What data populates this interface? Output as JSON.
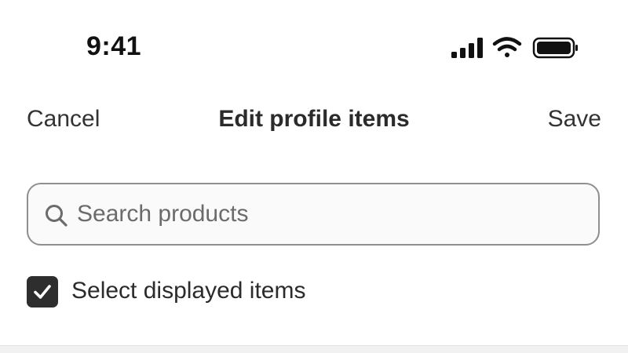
{
  "status_bar": {
    "time": "9:41",
    "icons": [
      "cellular-signal-icon",
      "wifi-icon",
      "battery-icon"
    ]
  },
  "nav": {
    "cancel_label": "Cancel",
    "title": "Edit profile items",
    "save_label": "Save"
  },
  "search": {
    "value": "",
    "placeholder": "Search products",
    "icon": "search-icon"
  },
  "select_displayed": {
    "label": "Select displayed items",
    "checked": true
  },
  "colors": {
    "checkbox_fill": "#2e2e2e",
    "search_border": "#8f8f8f",
    "text": "#2b2b2b"
  }
}
